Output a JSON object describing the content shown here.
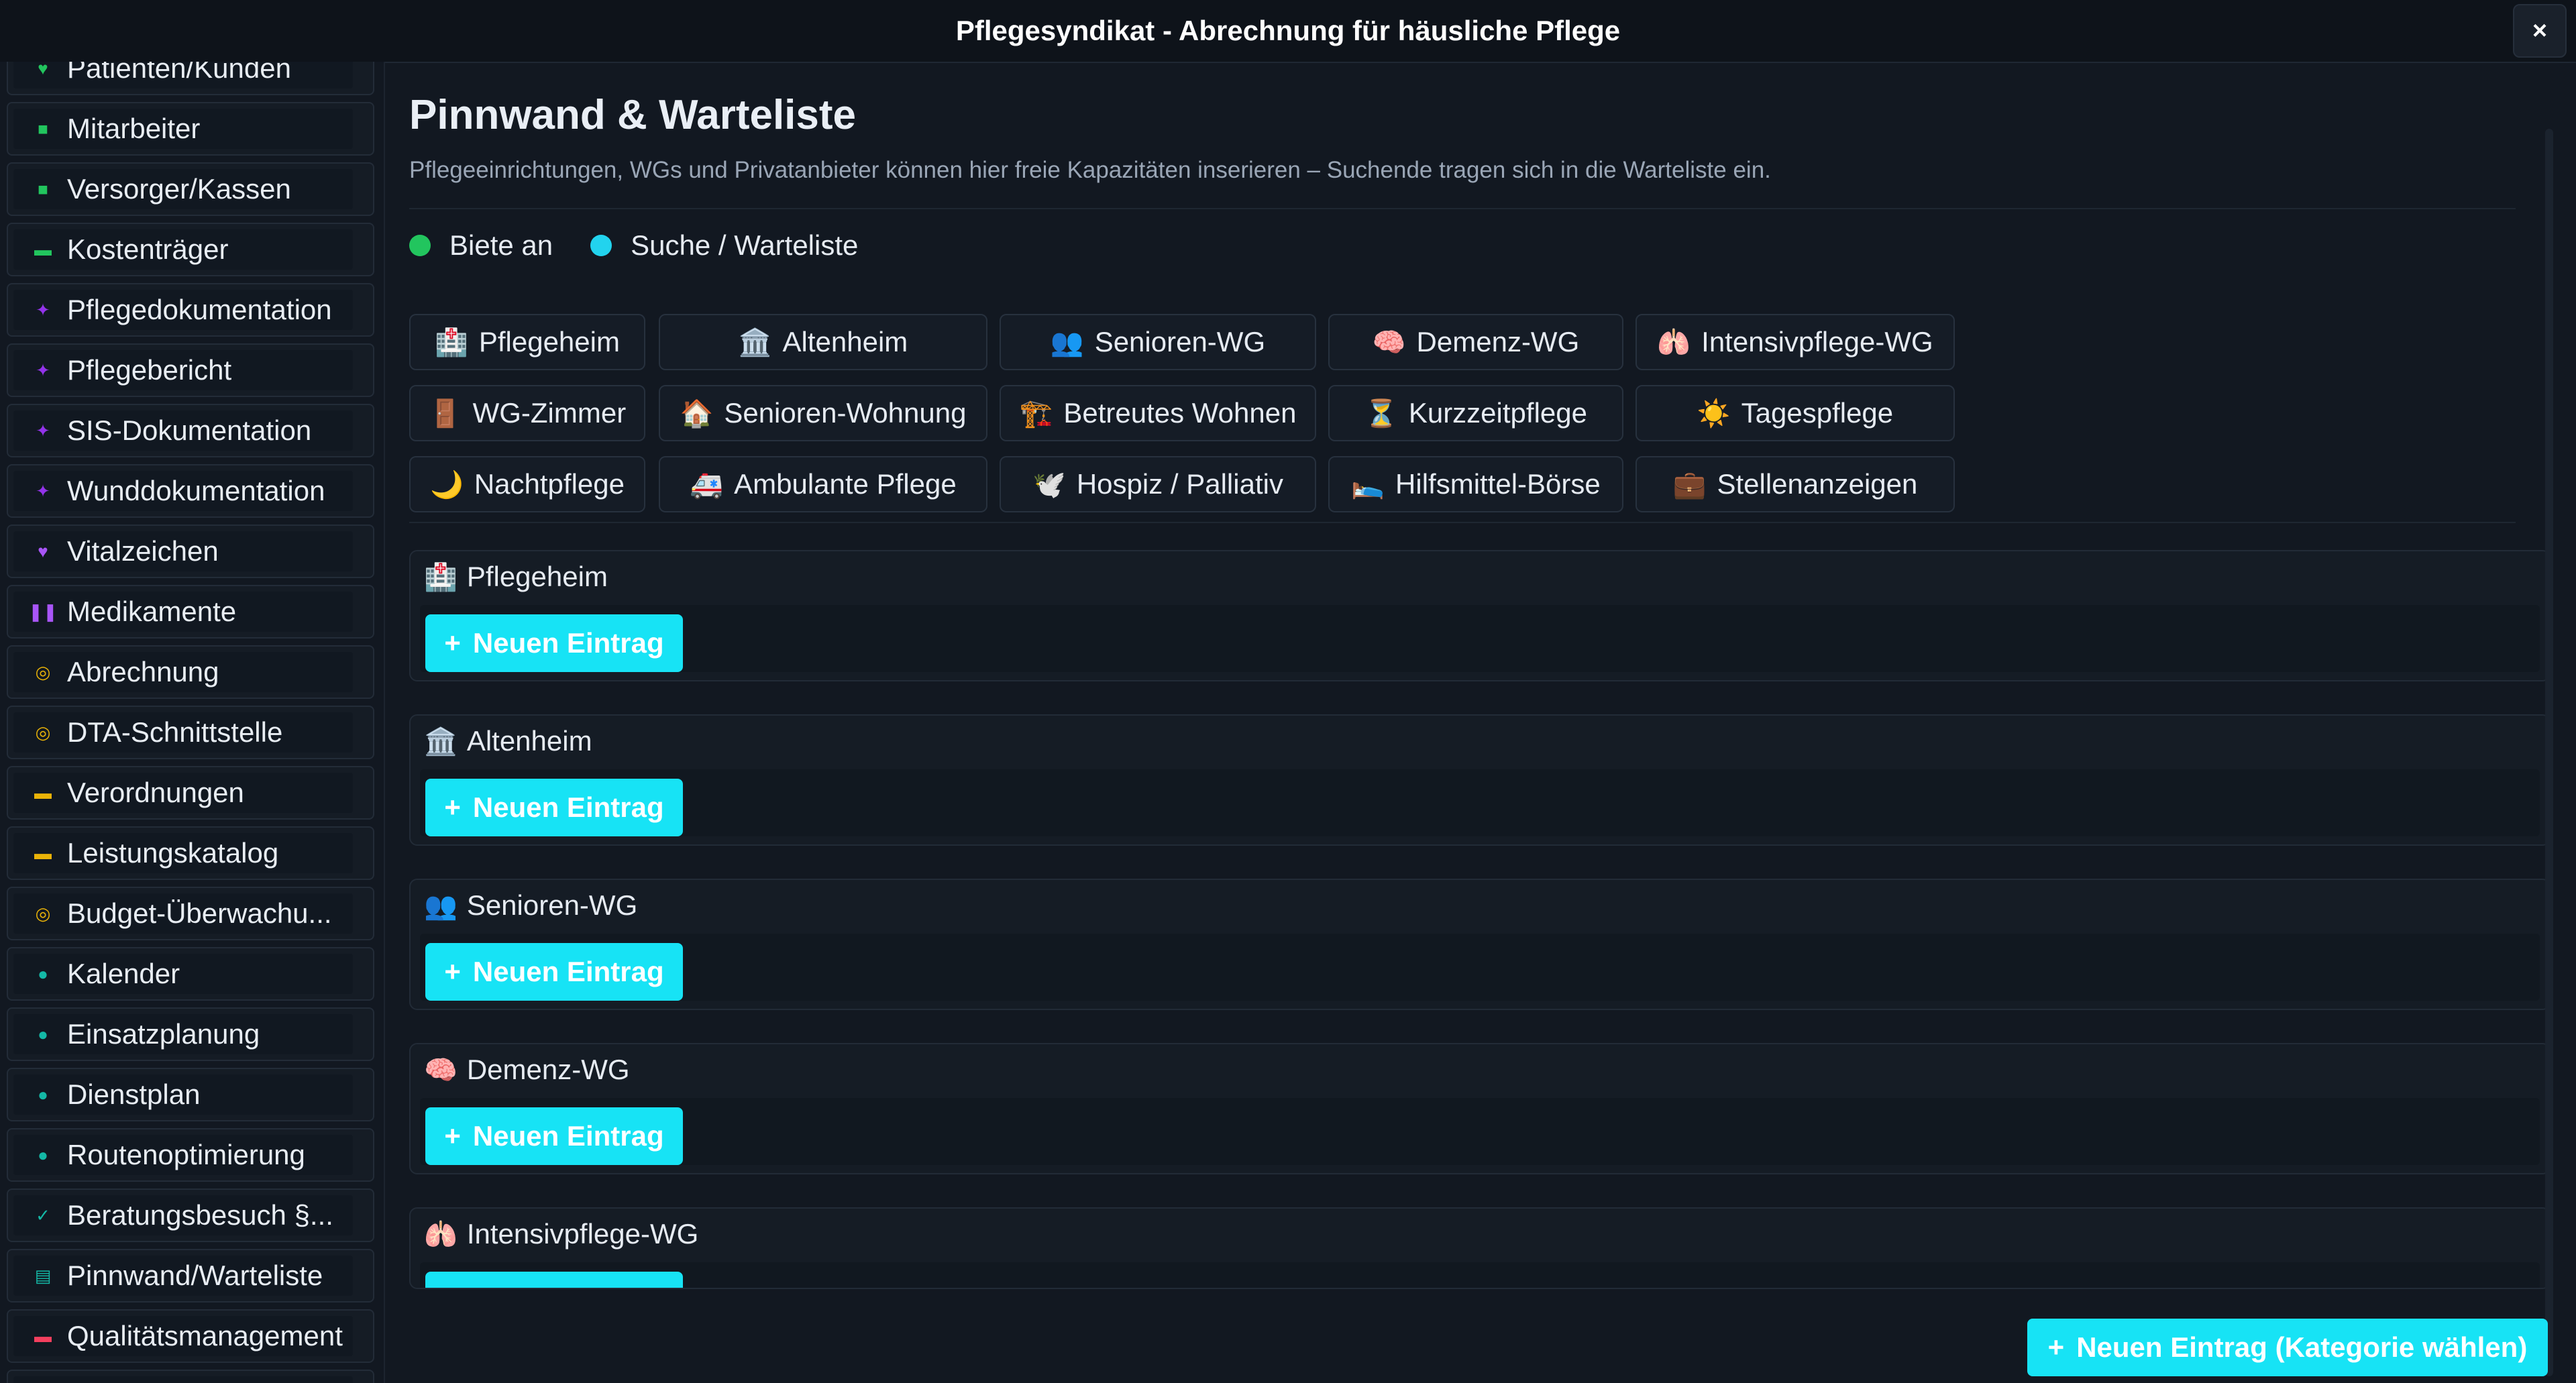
{
  "window": {
    "title": "Pflegesyndikat - Abrechnung für häusliche Pflege",
    "close_label": "×"
  },
  "colors": {
    "accent": "#17e3f5",
    "offer": "#22c55e",
    "search": "#22d3ee"
  },
  "sidebar": {
    "items": [
      {
        "label": "Patienten/Kunden",
        "icon": "heart-icon",
        "color": "#22c55e"
      },
      {
        "label": "Mitarbeiter",
        "icon": "robot-icon",
        "color": "#22c55e"
      },
      {
        "label": "Versorger/Kassen",
        "icon": "robot-icon",
        "color": "#22c55e"
      },
      {
        "label": "Kostenträger",
        "icon": "card-icon",
        "color": "#22c55e"
      },
      {
        "label": "Pflegedokumentation",
        "icon": "puzzle-icon",
        "color": "#9333ea"
      },
      {
        "label": "Pflegebericht",
        "icon": "puzzle-icon",
        "color": "#9333ea"
      },
      {
        "label": "SIS-Dokumentation",
        "icon": "puzzle-icon",
        "color": "#9333ea"
      },
      {
        "label": "Wunddokumentation",
        "icon": "puzzle-icon",
        "color": "#9333ea"
      },
      {
        "label": "Vitalzeichen",
        "icon": "heart-icon",
        "color": "#a855f7"
      },
      {
        "label": "Medikamente",
        "icon": "pause-icon",
        "color": "#a855f7"
      },
      {
        "label": "Abrechnung",
        "icon": "coin-icon",
        "color": "#eab308"
      },
      {
        "label": "DTA-Schnittstelle",
        "icon": "coin-icon",
        "color": "#eab308"
      },
      {
        "label": "Verordnungen",
        "icon": "card-icon",
        "color": "#eab308"
      },
      {
        "label": "Leistungskatalog",
        "icon": "card-icon",
        "color": "#eab308"
      },
      {
        "label": "Budget-Überwachu...",
        "icon": "coin-icon",
        "color": "#eab308"
      },
      {
        "label": "Kalender",
        "icon": "pin-icon",
        "color": "#14b8a6"
      },
      {
        "label": "Einsatzplanung",
        "icon": "pin-icon",
        "color": "#14b8a6"
      },
      {
        "label": "Dienstplan",
        "icon": "pin-icon",
        "color": "#14b8a6"
      },
      {
        "label": "Routenoptimierung",
        "icon": "pin-icon",
        "color": "#14b8a6"
      },
      {
        "label": "Beratungsbesuch §...",
        "icon": "check-icon",
        "color": "#14b8a6"
      },
      {
        "label": "Pinnwand/Warteliste",
        "icon": "board-icon",
        "color": "#14b8a6"
      },
      {
        "label": "Qualitätsmanagement",
        "icon": "card-icon",
        "color": "#f43f5e"
      },
      {
        "label": "",
        "icon": "",
        "color": "#151c25"
      }
    ]
  },
  "main": {
    "title": "Pinnwand & Warteliste",
    "description": "Pflegeeinrichtungen, WGs und Privatanbieter können hier freie Kapazitäten inserieren – Suchende tragen sich in die Warteliste ein.",
    "legend": {
      "offer": "Biete an",
      "search": "Suche / Warteliste"
    },
    "categories": [
      {
        "icon": "🏥",
        "label": "Pflegeheim"
      },
      {
        "icon": "🏛️",
        "label": "Altenheim"
      },
      {
        "icon": "👥",
        "label": "Senioren-WG"
      },
      {
        "icon": "🧠",
        "label": "Demenz-WG"
      },
      {
        "icon": "🫁",
        "label": "Intensivpflege-WG"
      },
      {
        "icon": "🚪",
        "label": "WG-Zimmer"
      },
      {
        "icon": "🏠",
        "label": "Senioren-Wohnung"
      },
      {
        "icon": "🏗️",
        "label": "Betreutes Wohnen"
      },
      {
        "icon": "⏳",
        "label": "Kurzzeitpflege"
      },
      {
        "icon": "☀️",
        "label": "Tagespflege"
      },
      {
        "icon": "🌙",
        "label": "Nachtpflege"
      },
      {
        "icon": "🚑",
        "label": "Ambulante Pflege"
      },
      {
        "icon": "🕊️",
        "label": "Hospiz / Palliativ"
      },
      {
        "icon": "🛌",
        "label": "Hilfsmittel-Börse"
      },
      {
        "icon": "💼",
        "label": "Stellenanzeigen"
      }
    ],
    "sections": [
      {
        "icon": "🏥",
        "label": "Pflegeheim"
      },
      {
        "icon": "🏛️",
        "label": "Altenheim"
      },
      {
        "icon": "👥",
        "label": "Senioren-WG"
      },
      {
        "icon": "🧠",
        "label": "Demenz-WG"
      },
      {
        "icon": "🫁",
        "label": "Intensivpflege-WG"
      }
    ],
    "add_entry_label": "Neuen Eintrag",
    "add_plus": "+",
    "fab_label": "Neuen Eintrag (Kategorie wählen)"
  }
}
